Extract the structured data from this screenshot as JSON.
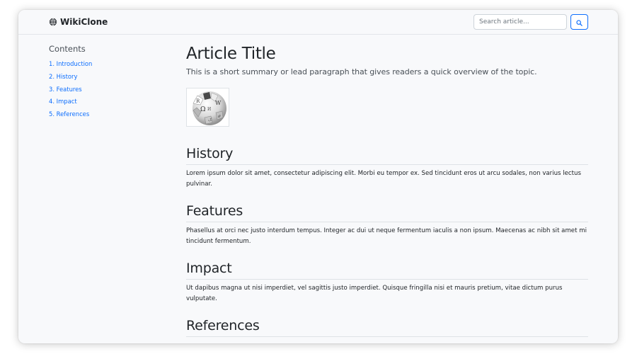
{
  "brand": {
    "name": "WikiClone",
    "icon": "globe-icon"
  },
  "search": {
    "placeholder": "Search article...",
    "value": "",
    "button_icon": "search-icon"
  },
  "toc": {
    "title": "Contents",
    "items": [
      {
        "label": "1. Introduction"
      },
      {
        "label": "2. History"
      },
      {
        "label": "3. Features"
      },
      {
        "label": "4. Impact"
      },
      {
        "label": "5. References"
      }
    ]
  },
  "article": {
    "title": "Article Title",
    "lead": "This is a short summary or lead paragraph that gives readers a quick overview of the topic.",
    "image": "wikipedia-globe-logo",
    "sections": [
      {
        "heading": "History",
        "body": "Lorem ipsum dolor sit amet, consectetur adipiscing elit. Morbi eu tempor ex. Sed tincidunt eros ut arcu sodales, non varius lectus pulvinar."
      },
      {
        "heading": "Features",
        "body": "Phasellus at orci nec justo interdum tempus. Integer ac dui ut neque fermentum iaculis a non ipsum. Maecenas ac nibh sit amet mi tincidunt fermentum."
      },
      {
        "heading": "Impact",
        "body": "Ut dapibus magna ut nisi imperdiet, vel sagittis justo imperdiet. Quisque fringilla nisi et mauris pretium, vitae dictum purus vulputate."
      },
      {
        "heading": "References",
        "body": ""
      }
    ]
  },
  "colors": {
    "link": "#0d6efd",
    "text": "#212529",
    "background": "#f8f9fb"
  }
}
